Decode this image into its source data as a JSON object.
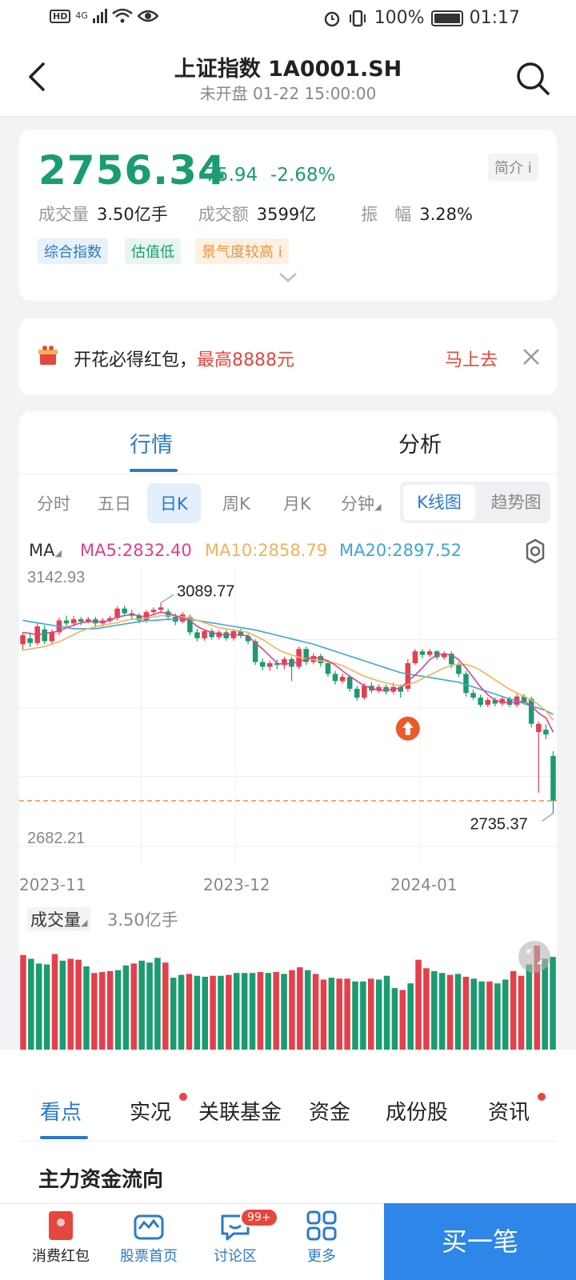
{
  "status_bar": {
    "hd": "HD",
    "network": "4G",
    "battery_pct": "100%",
    "time": "01:17"
  },
  "header": {
    "title": "上证指数 1A0001.SH",
    "subtitle": "未开盘 01-22 15:00:00"
  },
  "quote": {
    "price": "2756.34",
    "change": "-75.94",
    "change_pct": "-2.68%",
    "intro_label": "简介",
    "stats": [
      {
        "label": "成交量",
        "value": "3.50亿手"
      },
      {
        "label": "成交额",
        "value": "3599亿"
      },
      {
        "label": "振　幅",
        "value": "3.28%"
      }
    ],
    "tags": [
      "综合指数",
      "估值低",
      "景气度较高"
    ]
  },
  "promo": {
    "text": "开花必得红包，",
    "highlight": "最高8888元",
    "action": "马上去"
  },
  "tabs": {
    "market": "行情",
    "analysis": "分析"
  },
  "periods": [
    "分时",
    "五日",
    "日K",
    "周K",
    "月K",
    "分钟"
  ],
  "active_period": "日K",
  "chart_mode": {
    "kline": "K线图",
    "trend": "趋势图"
  },
  "ma": {
    "label": "MA",
    "ma5": "MA5:2832.40",
    "ma10": "MA10:2858.79",
    "ma20": "MA20:2897.52",
    "colors": {
      "ma5": "#e0408a",
      "ma10": "#f2b25a",
      "ma20": "#3ea5d7"
    }
  },
  "chart_data": {
    "type": "candlestick",
    "y_max_label": "3142.93",
    "y_min_label": "2682.21",
    "high_marker": "3089.77",
    "low_marker": "2735.37",
    "ylim": [
      2682.21,
      3142.93
    ],
    "x_labels": [
      "2023-11",
      "2023-12",
      "2024-01"
    ],
    "up_color": "#e4404b",
    "down_color": "#1a9c70",
    "candles": [
      {
        "o": 3020,
        "c": 3035,
        "h": 3040,
        "l": 3010
      },
      {
        "o": 3030,
        "c": 3022,
        "h": 3040,
        "l": 3015
      },
      {
        "o": 3022,
        "c": 3050,
        "h": 3055,
        "l": 3018
      },
      {
        "o": 3045,
        "c": 3025,
        "h": 3052,
        "l": 3020
      },
      {
        "o": 3025,
        "c": 3040,
        "h": 3045,
        "l": 3020
      },
      {
        "o": 3040,
        "c": 3060,
        "h": 3065,
        "l": 3035
      },
      {
        "o": 3060,
        "c": 3055,
        "h": 3068,
        "l": 3050
      },
      {
        "o": 3055,
        "c": 3062,
        "h": 3068,
        "l": 3050
      },
      {
        "o": 3062,
        "c": 3058,
        "h": 3066,
        "l": 3052
      },
      {
        "o": 3058,
        "c": 3062,
        "h": 3066,
        "l": 3055
      },
      {
        "o": 3062,
        "c": 3055,
        "h": 3066,
        "l": 3048
      },
      {
        "o": 3055,
        "c": 3060,
        "h": 3064,
        "l": 3050
      },
      {
        "o": 3060,
        "c": 3064,
        "h": 3068,
        "l": 3056
      },
      {
        "o": 3064,
        "c": 3080,
        "h": 3084,
        "l": 3060
      },
      {
        "o": 3080,
        "c": 3072,
        "h": 3085,
        "l": 3068
      },
      {
        "o": 3072,
        "c": 3068,
        "h": 3078,
        "l": 3062
      },
      {
        "o": 3068,
        "c": 3060,
        "h": 3072,
        "l": 3055
      },
      {
        "o": 3060,
        "c": 3074,
        "h": 3078,
        "l": 3056
      },
      {
        "o": 3074,
        "c": 3078,
        "h": 3082,
        "l": 3070
      },
      {
        "o": 3078,
        "c": 3082,
        "h": 3089.77,
        "l": 3072
      },
      {
        "o": 3075,
        "c": 3066,
        "h": 3080,
        "l": 3060
      },
      {
        "o": 3066,
        "c": 3058,
        "h": 3072,
        "l": 3052
      },
      {
        "o": 3058,
        "c": 3070,
        "h": 3074,
        "l": 3055
      },
      {
        "o": 3066,
        "c": 3040,
        "h": 3070,
        "l": 3035
      },
      {
        "o": 3040,
        "c": 3030,
        "h": 3046,
        "l": 3025
      },
      {
        "o": 3030,
        "c": 3042,
        "h": 3046,
        "l": 3026
      },
      {
        "o": 3042,
        "c": 3032,
        "h": 3046,
        "l": 3028
      },
      {
        "o": 3032,
        "c": 3040,
        "h": 3044,
        "l": 3028
      },
      {
        "o": 3040,
        "c": 3030,
        "h": 3044,
        "l": 3026
      },
      {
        "o": 3030,
        "c": 3042,
        "h": 3046,
        "l": 3026
      },
      {
        "o": 3042,
        "c": 3034,
        "h": 3046,
        "l": 3030
      },
      {
        "o": 3034,
        "c": 3025,
        "h": 3038,
        "l": 3020
      },
      {
        "o": 3025,
        "c": 2990,
        "h": 3028,
        "l": 2985
      },
      {
        "o": 2990,
        "c": 2982,
        "h": 2996,
        "l": 2976
      },
      {
        "o": 2982,
        "c": 2988,
        "h": 2992,
        "l": 2975
      },
      {
        "o": 2988,
        "c": 2985,
        "h": 2994,
        "l": 2978
      },
      {
        "o": 2985,
        "c": 2995,
        "h": 2999,
        "l": 2978
      },
      {
        "o": 2995,
        "c": 2982,
        "h": 2999,
        "l": 2958
      },
      {
        "o": 2982,
        "c": 3012,
        "h": 3016,
        "l": 2978
      },
      {
        "o": 3012,
        "c": 2990,
        "h": 3016,
        "l": 2985
      },
      {
        "o": 2990,
        "c": 3000,
        "h": 3005,
        "l": 2986
      },
      {
        "o": 3000,
        "c": 2988,
        "h": 3004,
        "l": 2982
      },
      {
        "o": 2988,
        "c": 2970,
        "h": 2992,
        "l": 2965
      },
      {
        "o": 2970,
        "c": 2958,
        "h": 2975,
        "l": 2952
      },
      {
        "o": 2958,
        "c": 2965,
        "h": 2970,
        "l": 2954
      },
      {
        "o": 2965,
        "c": 2945,
        "h": 2968,
        "l": 2940
      },
      {
        "o": 2945,
        "c": 2930,
        "h": 2950,
        "l": 2925
      },
      {
        "o": 2930,
        "c": 2950,
        "h": 2955,
        "l": 2926
      },
      {
        "o": 2950,
        "c": 2942,
        "h": 2956,
        "l": 2938
      },
      {
        "o": 2942,
        "c": 2948,
        "h": 2952,
        "l": 2938
      },
      {
        "o": 2948,
        "c": 2940,
        "h": 2952,
        "l": 2935
      },
      {
        "o": 2940,
        "c": 2948,
        "h": 2955,
        "l": 2936
      },
      {
        "o": 2948,
        "c": 2940,
        "h": 2952,
        "l": 2930
      },
      {
        "o": 2945,
        "c": 2988,
        "h": 2995,
        "l": 2940
      },
      {
        "o": 2988,
        "c": 3008,
        "h": 3012,
        "l": 2985
      },
      {
        "o": 3008,
        "c": 3002,
        "h": 3012,
        "l": 2996
      },
      {
        "o": 3002,
        "c": 3008,
        "h": 3012,
        "l": 2998
      },
      {
        "o": 3008,
        "c": 2998,
        "h": 3010,
        "l": 2994
      },
      {
        "o": 2998,
        "c": 3004,
        "h": 3008,
        "l": 2994
      },
      {
        "o": 3004,
        "c": 2986,
        "h": 3008,
        "l": 2980
      },
      {
        "o": 2986,
        "c": 2970,
        "h": 2990,
        "l": 2965
      },
      {
        "o": 2970,
        "c": 2938,
        "h": 2975,
        "l": 2932
      },
      {
        "o": 2938,
        "c": 2930,
        "h": 2944,
        "l": 2926
      },
      {
        "o": 2930,
        "c": 2918,
        "h": 2935,
        "l": 2914
      },
      {
        "o": 2918,
        "c": 2926,
        "h": 2930,
        "l": 2914
      },
      {
        "o": 2926,
        "c": 2920,
        "h": 2930,
        "l": 2915
      },
      {
        "o": 2920,
        "c": 2928,
        "h": 2932,
        "l": 2916
      },
      {
        "o": 2928,
        "c": 2918,
        "h": 2932,
        "l": 2914
      },
      {
        "o": 2918,
        "c": 2932,
        "h": 2936,
        "l": 2914
      },
      {
        "o": 2932,
        "c": 2922,
        "h": 2936,
        "l": 2918
      },
      {
        "o": 2928,
        "c": 2886,
        "h": 2932,
        "l": 2880
      },
      {
        "o": 2872,
        "c": 2886,
        "h": 2890,
        "l": 2770
      },
      {
        "o": 2876,
        "c": 2868,
        "h": 2885,
        "l": 2860
      },
      {
        "o": 2832,
        "c": 2756.34,
        "h": 2840,
        "l": 2735.37
      }
    ],
    "ma5": [
      3040,
      3038,
      3036,
      3038,
      3040,
      3042,
      3048,
      3052,
      3056,
      3058,
      3058,
      3058,
      3060,
      3066,
      3068,
      3070,
      3068,
      3066,
      3070,
      3074,
      3072,
      3068,
      3064,
      3060,
      3050,
      3044,
      3040,
      3036,
      3036,
      3036,
      3036,
      3034,
      3022,
      3012,
      3000,
      2988,
      2986,
      2988,
      2990,
      2995,
      2998,
      2996,
      2992,
      2985,
      2975,
      2966,
      2958,
      2950,
      2946,
      2942,
      2943,
      2944,
      2946,
      2958,
      2968,
      2980,
      2994,
      3002,
      3004,
      3002,
      2994,
      2980,
      2964,
      2948,
      2935,
      2926,
      2922,
      2922,
      2922,
      2924,
      2916,
      2904,
      2896,
      2872
    ],
    "ma10": [
      3010,
      3012,
      3014,
      3016,
      3020,
      3024,
      3030,
      3036,
      3042,
      3046,
      3050,
      3052,
      3054,
      3056,
      3060,
      3062,
      3062,
      3064,
      3066,
      3068,
      3068,
      3068,
      3066,
      3064,
      3060,
      3056,
      3052,
      3048,
      3046,
      3044,
      3042,
      3040,
      3034,
      3028,
      3020,
      3012,
      3006,
      3002,
      2998,
      2996,
      2994,
      2992,
      2990,
      2988,
      2984,
      2978,
      2972,
      2966,
      2962,
      2958,
      2955,
      2952,
      2950,
      2952,
      2956,
      2962,
      2968,
      2974,
      2980,
      2984,
      2986,
      2986,
      2982,
      2976,
      2968,
      2960,
      2952,
      2944,
      2938,
      2932,
      2926,
      2918,
      2908,
      2892
    ],
    "ma20": [
      3060,
      3058,
      3056,
      3054,
      3052,
      3050,
      3048,
      3046,
      3046,
      3046,
      3046,
      3048,
      3050,
      3052,
      3054,
      3056,
      3058,
      3060,
      3060,
      3061,
      3062,
      3062,
      3062,
      3061,
      3060,
      3058,
      3056,
      3054,
      3052,
      3050,
      3048,
      3046,
      3044,
      3041,
      3038,
      3035,
      3032,
      3029,
      3026,
      3023,
      3020,
      3016,
      3012,
      3008,
      3004,
      3000,
      2996,
      2992,
      2988,
      2984,
      2980,
      2976,
      2972,
      2970,
      2968,
      2966,
      2964,
      2962,
      2960,
      2958,
      2956,
      2952,
      2948,
      2944,
      2940,
      2936,
      2932,
      2928,
      2924,
      2920,
      2916,
      2912,
      2908,
      2902
    ]
  },
  "volume": {
    "label": "成交量",
    "value": "3.50亿手",
    "bars": [
      {
        "v": 100,
        "up": true
      },
      {
        "v": 96,
        "up": false
      },
      {
        "v": 91,
        "up": false
      },
      {
        "v": 90,
        "up": false
      },
      {
        "v": 101,
        "up": true
      },
      {
        "v": 94,
        "up": false
      },
      {
        "v": 96,
        "up": true
      },
      {
        "v": 95,
        "up": true
      },
      {
        "v": 88,
        "up": false
      },
      {
        "v": 81,
        "up": true
      },
      {
        "v": 82,
        "up": true
      },
      {
        "v": 83,
        "up": true
      },
      {
        "v": 84,
        "up": false
      },
      {
        "v": 89,
        "up": false
      },
      {
        "v": 91,
        "up": true
      },
      {
        "v": 94,
        "up": false
      },
      {
        "v": 92,
        "up": false
      },
      {
        "v": 97,
        "up": false
      },
      {
        "v": 92,
        "up": true
      },
      {
        "v": 76,
        "up": false
      },
      {
        "v": 79,
        "up": false
      },
      {
        "v": 80,
        "up": true
      },
      {
        "v": 78,
        "up": false
      },
      {
        "v": 77,
        "up": false
      },
      {
        "v": 78,
        "up": true
      },
      {
        "v": 78,
        "up": false
      },
      {
        "v": 79,
        "up": true
      },
      {
        "v": 81,
        "up": false
      },
      {
        "v": 81,
        "up": false
      },
      {
        "v": 81,
        "up": false
      },
      {
        "v": 82,
        "up": true
      },
      {
        "v": 81,
        "up": false
      },
      {
        "v": 82,
        "up": true
      },
      {
        "v": 80,
        "up": false
      },
      {
        "v": 84,
        "up": true
      },
      {
        "v": 87,
        "up": true
      },
      {
        "v": 84,
        "up": false
      },
      {
        "v": 80,
        "up": true
      },
      {
        "v": 74,
        "up": true
      },
      {
        "v": 76,
        "up": false
      },
      {
        "v": 75,
        "up": true
      },
      {
        "v": 75,
        "up": true
      },
      {
        "v": 72,
        "up": false
      },
      {
        "v": 72,
        "up": false
      },
      {
        "v": 75,
        "up": true
      },
      {
        "v": 74,
        "up": false
      },
      {
        "v": 78,
        "up": false
      },
      {
        "v": 65,
        "up": false
      },
      {
        "v": 63,
        "up": true
      },
      {
        "v": 70,
        "up": false
      },
      {
        "v": 95,
        "up": true
      },
      {
        "v": 86,
        "up": true
      },
      {
        "v": 83,
        "up": false
      },
      {
        "v": 81,
        "up": false
      },
      {
        "v": 79,
        "up": true
      },
      {
        "v": 80,
        "up": false
      },
      {
        "v": 77,
        "up": true
      },
      {
        "v": 75,
        "up": false
      },
      {
        "v": 72,
        "up": false
      },
      {
        "v": 72,
        "up": true
      },
      {
        "v": 70,
        "up": false
      },
      {
        "v": 74,
        "up": false
      },
      {
        "v": 83,
        "up": true
      },
      {
        "v": 78,
        "up": true
      },
      {
        "v": 90,
        "up": false
      },
      {
        "v": 110,
        "up": true
      },
      {
        "v": 96,
        "up": false
      },
      {
        "v": 98,
        "up": false
      }
    ]
  },
  "bottom_tabs": [
    {
      "label": "看点",
      "dot": false
    },
    {
      "label": "实况",
      "dot": true
    },
    {
      "label": "关联基金",
      "dot": false
    },
    {
      "label": "资金",
      "dot": false
    },
    {
      "label": "成份股",
      "dot": false
    },
    {
      "label": "资讯",
      "dot": true
    }
  ],
  "section_title": "主力资金流向",
  "bottom_nav": {
    "items": [
      "消费红包",
      "股票首页",
      "讨论区",
      "更多"
    ],
    "badge": "99+",
    "buy": "买一笔"
  }
}
